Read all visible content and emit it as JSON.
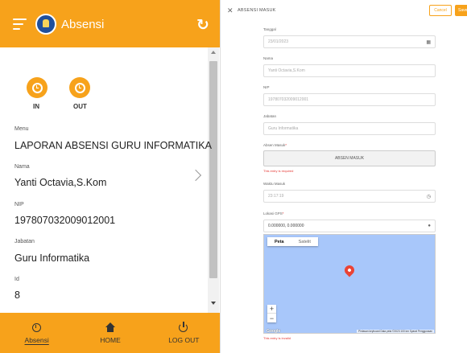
{
  "mobile": {
    "app_bar": {
      "title": "Absensi",
      "brand_color": "#f7a21b"
    },
    "attendance": {
      "in_label": "IN",
      "out_label": "OUT"
    },
    "fields": [
      {
        "label": "Menu",
        "value": "LAPORAN ABSENSI GURU INFORMATIKA"
      },
      {
        "label": "Nama",
        "value": "Yanti Octavia,S.Kom"
      },
      {
        "label": "NIP",
        "value": "197807032009012001"
      },
      {
        "label": "Jabatan",
        "value": "Guru Informatika"
      },
      {
        "label": "Id",
        "value": "8"
      }
    ],
    "bottom_nav": [
      {
        "label": "Absensi",
        "icon": "alarm-clock-icon",
        "active": true
      },
      {
        "label": "HOME",
        "icon": "home-icon",
        "active": false
      },
      {
        "label": "LOG OUT",
        "icon": "power-icon",
        "active": false
      }
    ]
  },
  "form": {
    "title": "ABSENSI MASUK",
    "cancel_label": "Cancel",
    "save_label": "Save",
    "fields": {
      "tanggal": {
        "label": "Tanggal",
        "value": "23/01/2023"
      },
      "nama": {
        "label": "Nama",
        "value": "Yanti Octavia,S.Kom"
      },
      "nip": {
        "label": "NIP",
        "value": "197807032009012001"
      },
      "jabatan": {
        "label": "Jabatan",
        "value": "Guru Informatika"
      },
      "absen_masuk": {
        "label": "Absen Masuk",
        "button_label": "ABSEN MASUK",
        "error": "This entry is required"
      },
      "waktu_masuk": {
        "label": "Waktu Masuk",
        "value": "23:17:19"
      },
      "lokasi": {
        "label": "Lokasi GPS",
        "value": "0.000000, 0.000000",
        "error": "This entry is invalid"
      }
    },
    "map": {
      "tab_map": "Peta",
      "tab_satellite": "Satelit",
      "zoom_in": "+",
      "zoom_out": "−",
      "google": "Google",
      "attribution": "Pintasan keyboard  Data peta ©2023  100 km  Syarat Penggunaan"
    }
  }
}
